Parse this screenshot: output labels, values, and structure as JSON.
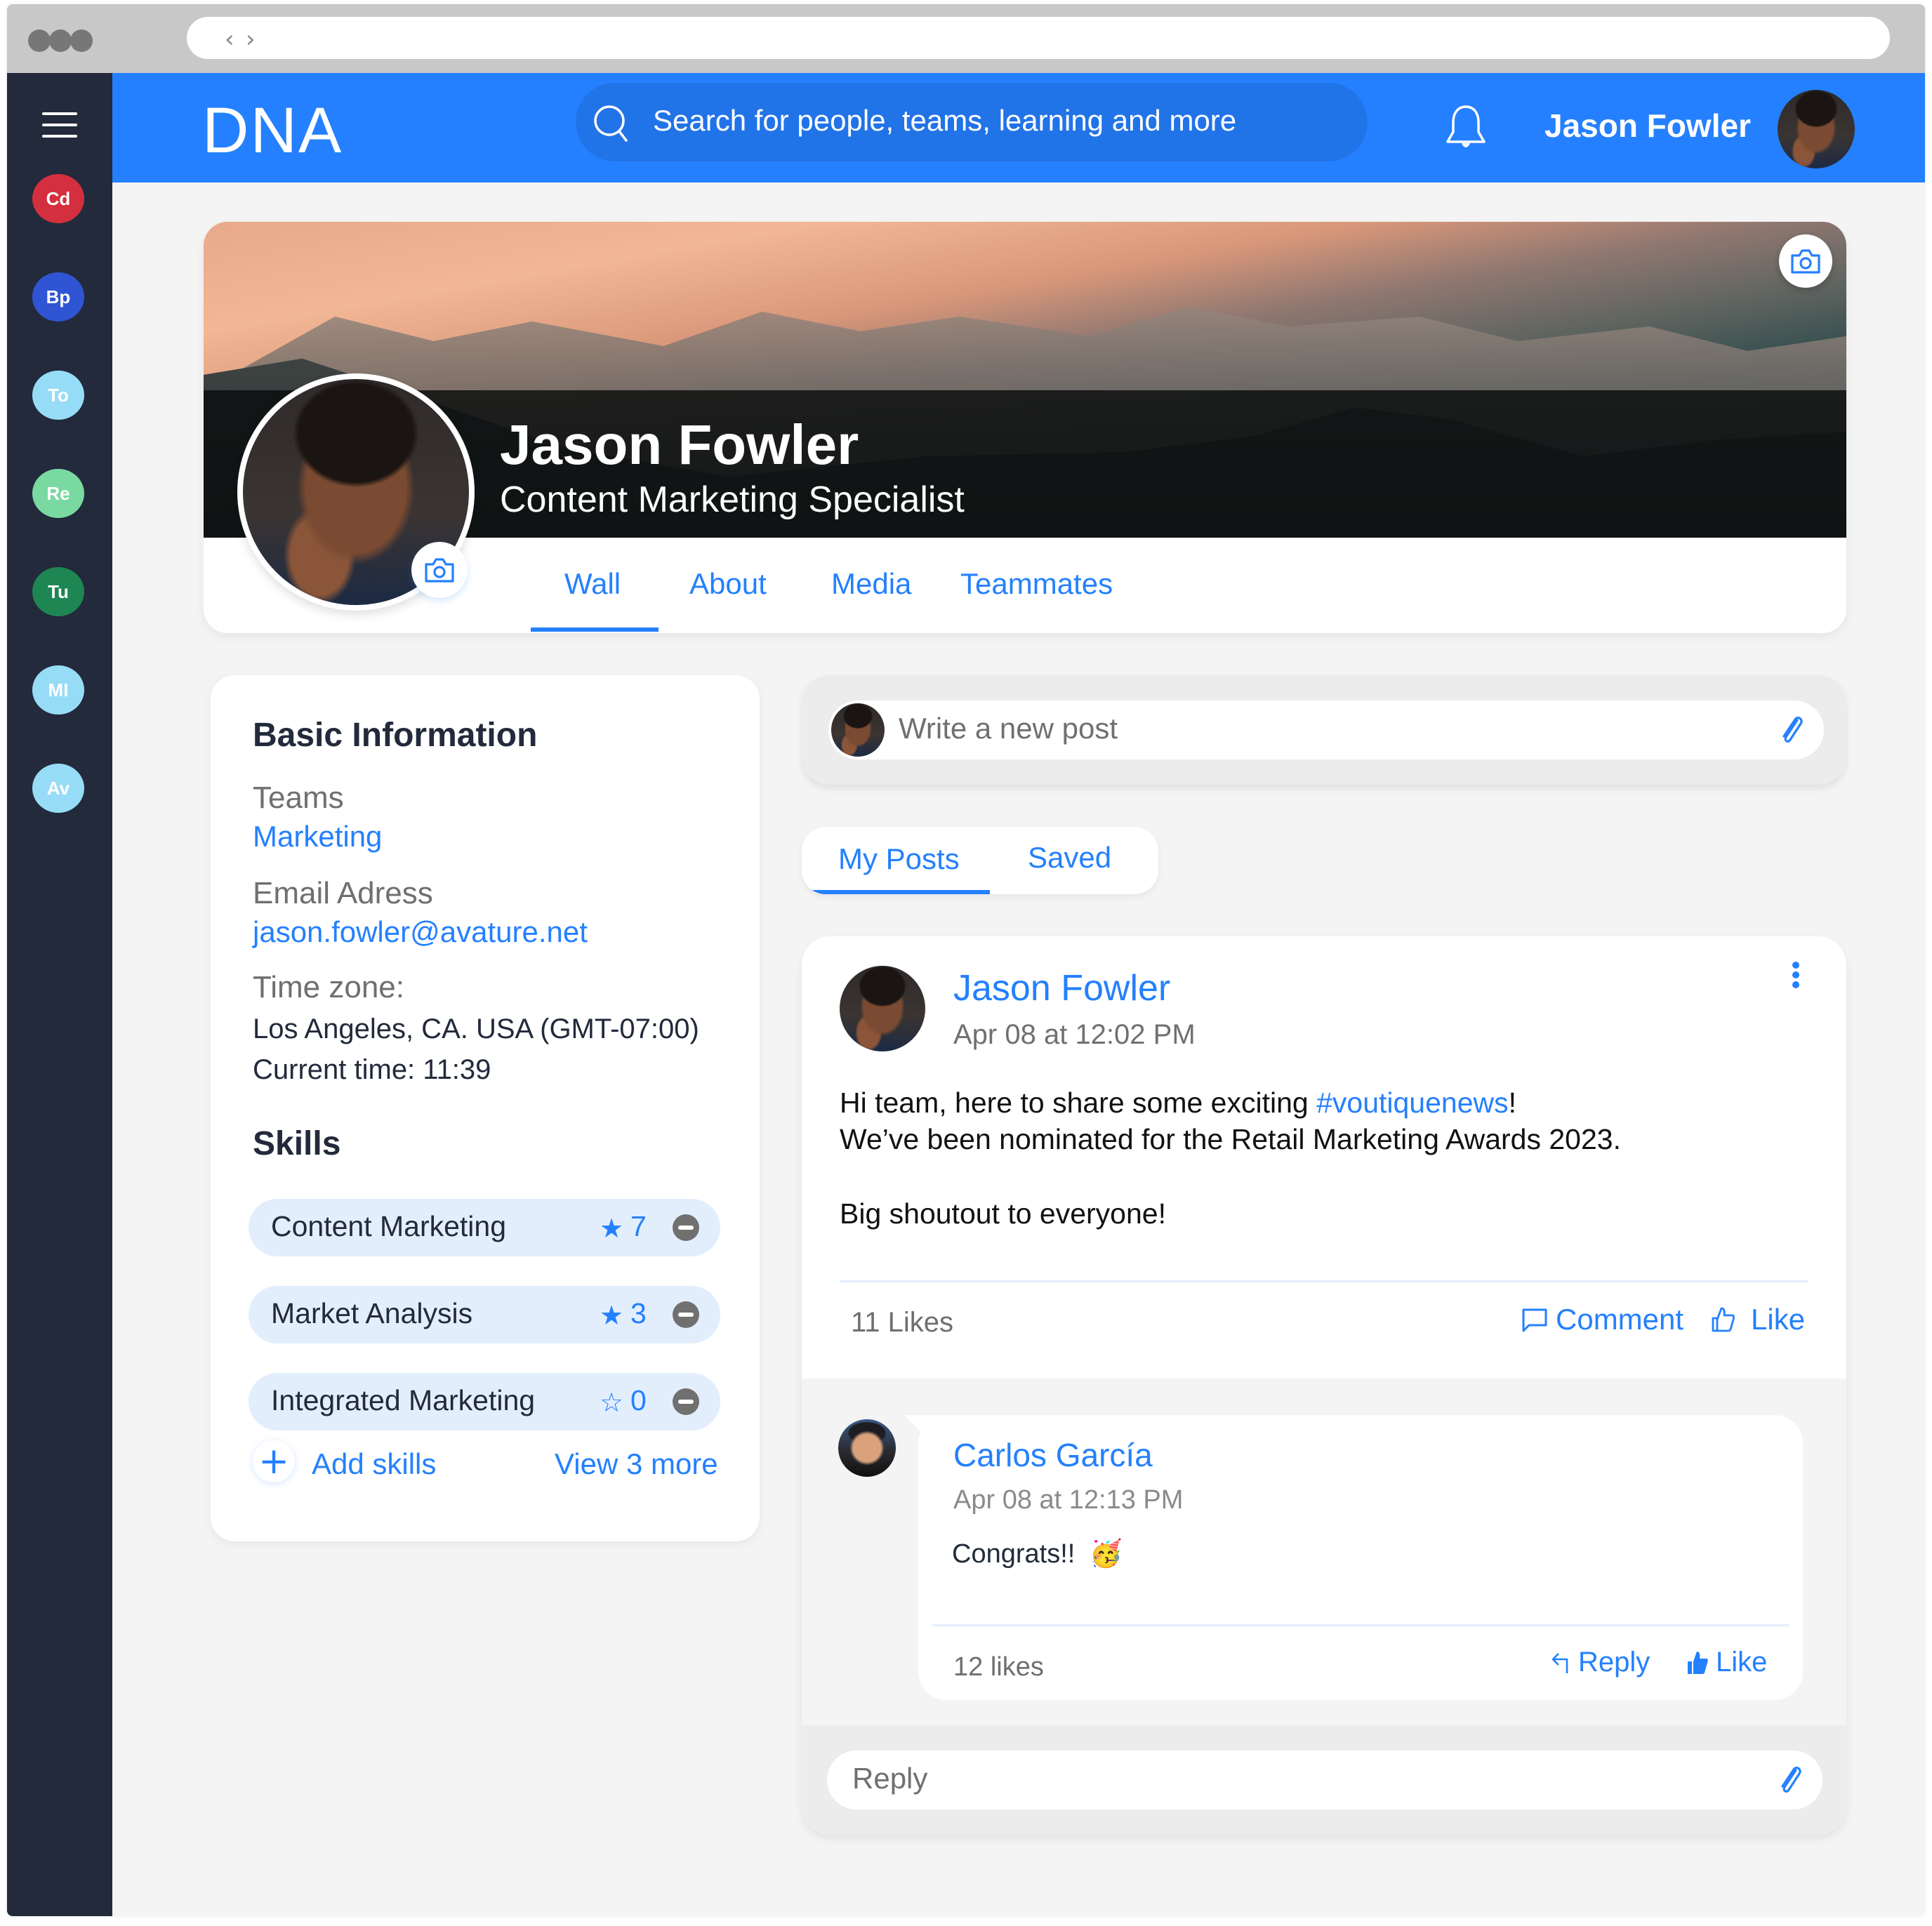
{
  "browser": {
    "back_icon": "chevron-left-icon",
    "forward_icon": "chevron-right-icon"
  },
  "sidebar": {
    "menu_icon": "hamburger-icon",
    "teams": [
      {
        "initials": "Cd",
        "color": "#d42f3e"
      },
      {
        "initials": "Bp",
        "color": "#2f55d4"
      },
      {
        "initials": "To",
        "color": "#97dcf7"
      },
      {
        "initials": "Re",
        "color": "#79d9a0"
      },
      {
        "initials": "Tu",
        "color": "#1d8653"
      },
      {
        "initials": "MI",
        "color": "#97dcf7"
      },
      {
        "initials": "Av",
        "color": "#97dcf7"
      }
    ]
  },
  "header": {
    "logo": "DNA",
    "search_placeholder": "Search for people, teams, learning and more",
    "notification_icon": "bell-icon",
    "user_name": "Jason Fowler",
    "brand_color": "#2480fe"
  },
  "profile": {
    "name": "Jason Fowler",
    "title": "Content Marketing Specialist",
    "tabs": [
      {
        "label": "Wall",
        "active": true
      },
      {
        "label": "About",
        "active": false
      },
      {
        "label": "Media",
        "active": false
      },
      {
        "label": "Teammates",
        "active": false
      }
    ]
  },
  "basic_info": {
    "heading": "Basic Information",
    "teams_label": "Teams",
    "teams_value": "Marketing",
    "email_label": "Email Adress",
    "email_value": "jason.fowler@avature.net",
    "timezone_label": "Time zone:",
    "timezone_value": "Los Angeles, CA. USA  (GMT-07:00)",
    "current_time": "Current time: 11:39"
  },
  "skills": {
    "heading": "Skills",
    "items": [
      {
        "name": "Content Marketing",
        "endorsements": "7",
        "starred": true,
        "star": "★"
      },
      {
        "name": "Market Analysis",
        "endorsements": "3",
        "starred": true,
        "star": "★"
      },
      {
        "name": "Integrated Marketing",
        "endorsements": "0",
        "starred": false,
        "star": "☆"
      }
    ],
    "add_label": "Add skills",
    "view_more_label": "View 3 more"
  },
  "composer": {
    "placeholder": "Write a new post"
  },
  "post_tabs": [
    {
      "label": "My Posts",
      "active": true
    },
    {
      "label": "Saved",
      "active": false
    }
  ],
  "post": {
    "author": "Jason Fowler",
    "timestamp": "Apr 08 at 12:02 PM",
    "line1_before": "Hi team, here to share some exciting ",
    "hashtag": "#voutiquenews",
    "line1_after": "!",
    "line2": "We’ve been nominated for the Retail Marketing Awards 2023.",
    "line3": "Big shoutout to everyone!",
    "likes": "11 Likes",
    "comment_label": "Comment",
    "like_label": "Like"
  },
  "comment": {
    "author": "Carlos García",
    "timestamp": "Apr 08 at 12:13 PM",
    "text": "Congrats!!",
    "emoji": "🥳",
    "likes": "12 likes",
    "reply_label": "Reply",
    "like_label": "Like"
  },
  "reply_box": {
    "placeholder": "Reply"
  }
}
